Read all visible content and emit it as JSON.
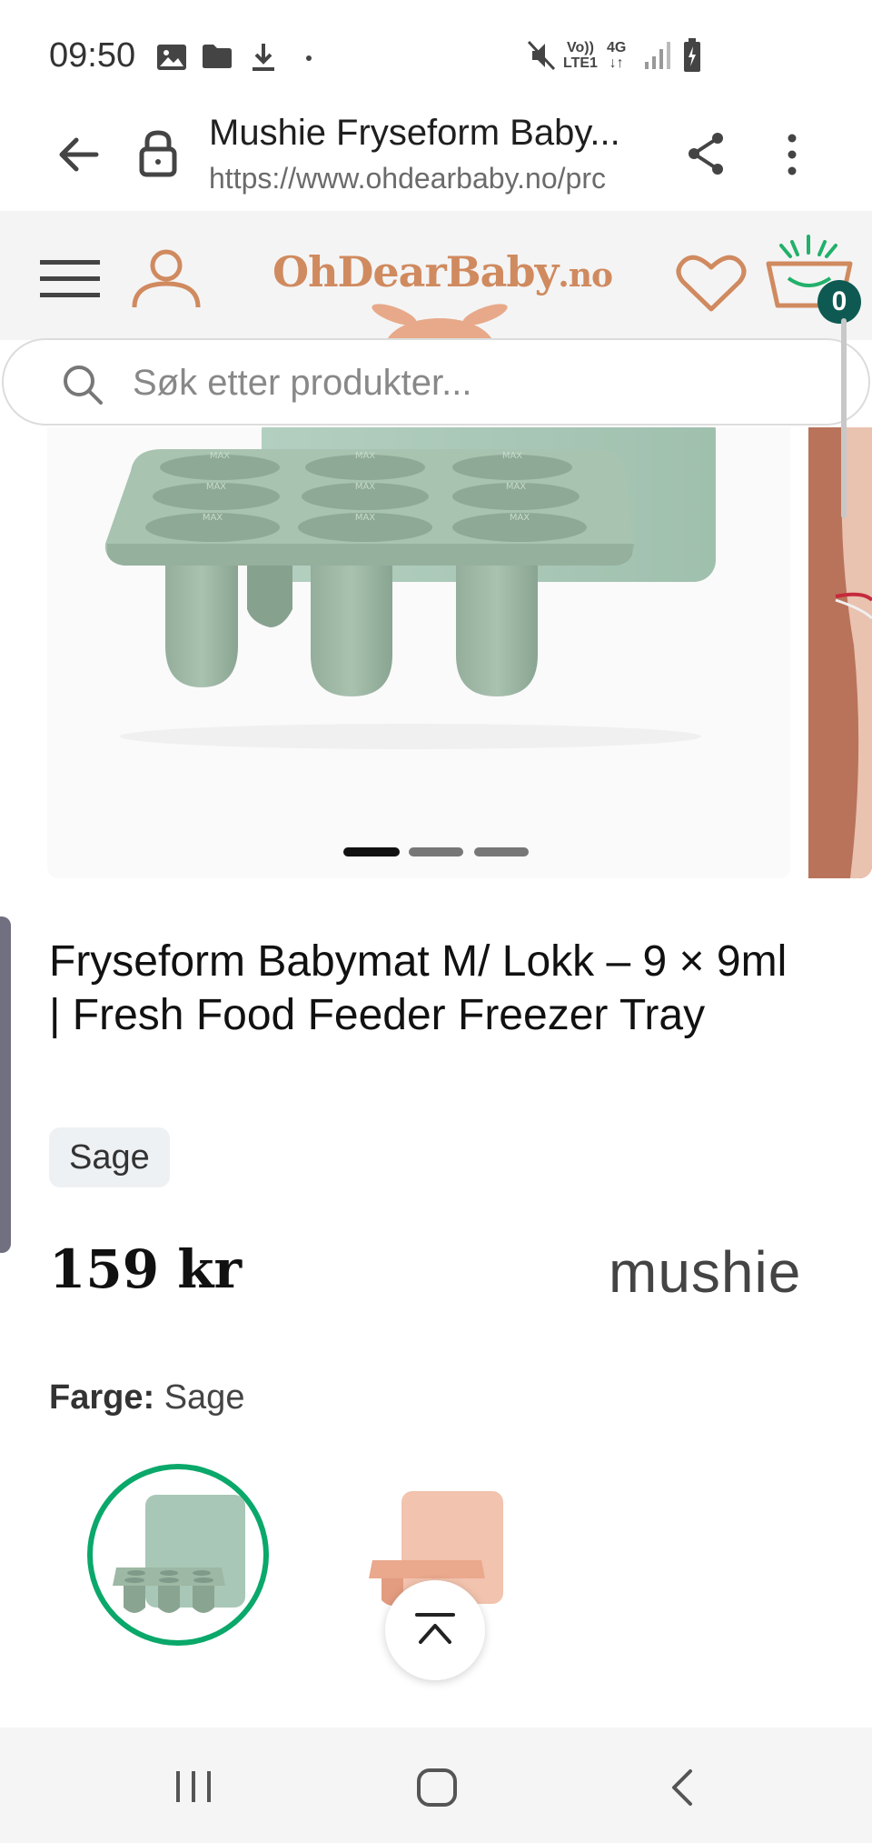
{
  "status_bar": {
    "time": "09:50",
    "icons": [
      "gallery-icon",
      "folder-icon",
      "download-icon",
      "dot-icon",
      "mute-icon",
      "volte-icon",
      "4g-icon",
      "signal-icon",
      "battery-icon"
    ],
    "network_top": "Vo))",
    "network_bottom": "LTE1",
    "data_type": "4G"
  },
  "browser": {
    "page_title": "Mushie Fryseform Baby...",
    "url": "https://www.ohdearbaby.no/prc"
  },
  "site_header": {
    "logo_text": "OhDearBaby",
    "logo_tld": ".no",
    "cart_count": "0"
  },
  "search": {
    "placeholder": "Søk etter produkter..."
  },
  "product": {
    "title": "Fryseform Babymat M/ Lokk – 9 × 9ml | Fresh Food Feeder Freezer Tray",
    "variant_chip": "Sage",
    "price": "159 kr",
    "brand": "mushie",
    "color_label": "Farge:",
    "color_value": "Sage",
    "tray_label": "MAX",
    "carousel": {
      "total": 3,
      "active": 1
    },
    "swatches": [
      {
        "name": "Sage",
        "selected": true,
        "color": "#9cb8a3"
      },
      {
        "name": "Peach",
        "selected": false,
        "color": "#f2c3ae"
      }
    ]
  },
  "colors": {
    "brand_orange": "#d08a5f",
    "badge_teal": "#0e5a52",
    "selected_green": "#0aa86a",
    "sage": "#9cb8a3"
  }
}
